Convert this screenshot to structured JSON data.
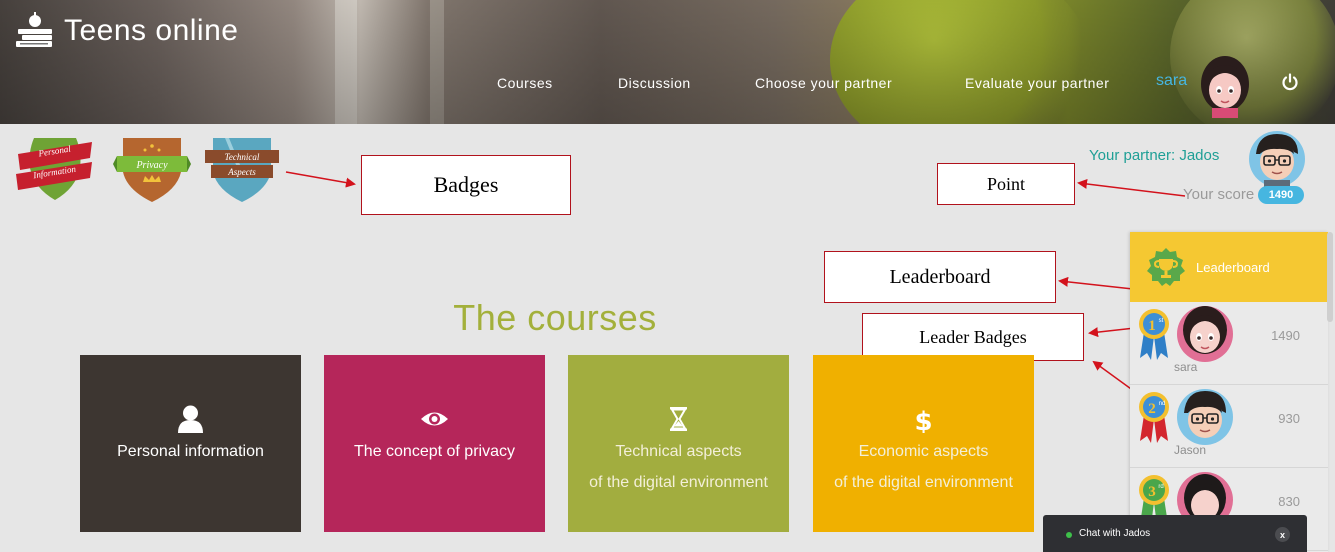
{
  "header": {
    "brand": "Teens online",
    "nav": [
      {
        "label": "Courses"
      },
      {
        "label": "Discussion"
      },
      {
        "label": "Choose your partner"
      },
      {
        "label": "Evaluate your partner"
      }
    ],
    "username": "sara",
    "user_avatar_icon": "girl-avatar-icon",
    "logout_icon": "power-icon"
  },
  "badges": [
    {
      "label_line1": "Personal",
      "label_line2": "Information",
      "color": "#6fa335"
    },
    {
      "label_line1": "Privacy",
      "label_line2": "",
      "color": "#b5662f"
    },
    {
      "label_line1": "Technical",
      "label_line2": "Aspects",
      "color": "#5aa7c0"
    }
  ],
  "annotations": {
    "badges": "Badges",
    "point": "Point",
    "leaderboard": "Leaderboard",
    "leader_badges": "Leader Badges"
  },
  "partner": {
    "label": "Your partner: Jados",
    "score_label": "Your score",
    "score": "1490"
  },
  "courses": {
    "title": "The courses",
    "items": [
      {
        "icon": "user-icon",
        "line1": "Personal information",
        "line2": "",
        "color": "#3d3631"
      },
      {
        "icon": "eye-icon",
        "line1": "The concept of privacy",
        "line2": "",
        "color": "#b5265a"
      },
      {
        "icon": "hourglass-icon",
        "line1": "Technical aspects",
        "line2": "of the digital environment",
        "color": "#a2ad3f"
      },
      {
        "icon": "dollar-icon",
        "line1": "Economic aspects",
        "line2": "of the digital environment",
        "color": "#f0b000"
      }
    ]
  },
  "leaderboard": {
    "title": "Leaderboard",
    "rows": [
      {
        "rank": "1",
        "rank_suffix": "st",
        "name": "sara",
        "score": "1490"
      },
      {
        "rank": "2",
        "rank_suffix": "nd",
        "name": "Jason",
        "score": "930"
      },
      {
        "rank": "3",
        "rank_suffix": "rd",
        "name": "",
        "score": "830"
      }
    ]
  },
  "chat": {
    "label": "Chat with Jados",
    "close": "x"
  },
  "colors": {
    "accent_teal": "#1f9f96",
    "accent_blue": "#46b6e0",
    "title_green": "#a3b03b",
    "leaderboard_yellow": "#f5c832",
    "annotation_red": "#b1121c"
  }
}
